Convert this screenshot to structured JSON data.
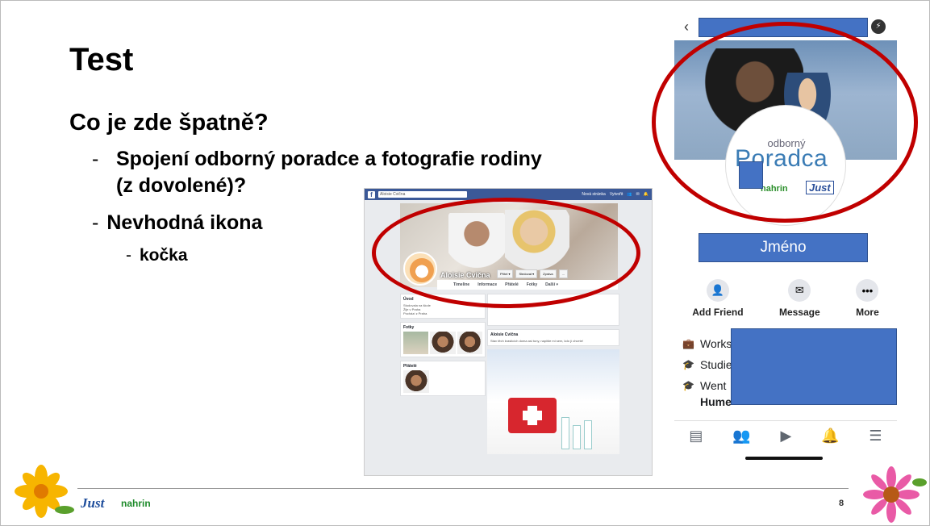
{
  "slide": {
    "title": "Test",
    "question": "Co je zde špatně?",
    "bullet1": "Spojení odborný poradce a fotografie rodiny (z dovolené)?",
    "bullet2": "Nevhodná ikona",
    "bullet3": "kočka",
    "dash": "-",
    "page_number": "8"
  },
  "fb_desktop": {
    "search": "Aloisie Cvična",
    "nav": [
      "Nová stránka",
      "Vytvořit"
    ],
    "profile_name": "Aloisie Cvična",
    "cover_buttons": [
      "Přítel ▾",
      "Sledovat ▾",
      "Zpráva",
      "..."
    ],
    "tabs": [
      "Timeline",
      "Informace",
      "Přátelé",
      "Fotky",
      "Další ▾"
    ],
    "intro_title": "Úvod",
    "intro_lines": [
      "Studovala na škole",
      "Žije v Praha",
      "Pochází z Praha"
    ],
    "photos_title": "Fotky",
    "friends_title": "Přátelé",
    "post_author": "Aloisie Cvična",
    "post_text": "Stav těch kraslicích doma asi tuny, napište mi sem, kdo jí chcete!"
  },
  "fb_mobile": {
    "back_icon": "chevron-left-icon",
    "cover_text_small": "odborný",
    "cover_text_big": "Poradca",
    "logo_nahrin": "nahrin",
    "logo_just": "Just",
    "name_label": "Jméno",
    "actions": [
      {
        "label": "Add Friend",
        "icon": "add-friend-icon"
      },
      {
        "label": "Message",
        "icon": "messenger-icon"
      },
      {
        "label": "More",
        "icon": "more-icon"
      }
    ],
    "info": [
      "Works",
      "Studie",
      "Went",
      "Hume"
    ]
  },
  "footer": {
    "logo_just": "Just",
    "logo_nahrin": "nahrin"
  },
  "colors": {
    "highlight_red": "#c00000",
    "redaction_blue": "#4472c4",
    "facebook_blue": "#3b5998"
  }
}
